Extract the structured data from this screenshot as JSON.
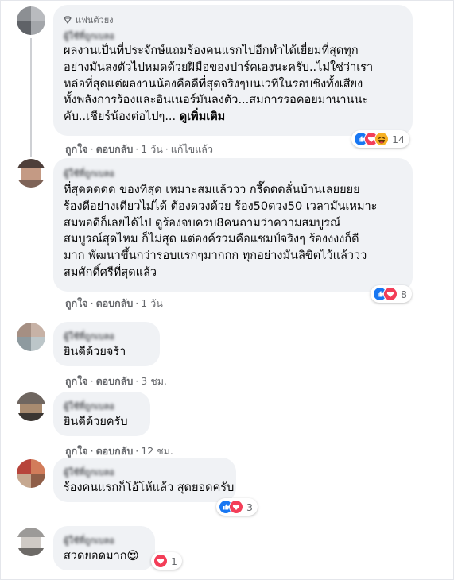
{
  "colors": {
    "bubble": "#f0f2f5",
    "like_blue": "#1877f2",
    "love_red": "#f33e58",
    "haha_yellow": "#f7b125",
    "meta_text": "#65676b"
  },
  "comments": [
    {
      "badge": "แฟนตัวยง",
      "badge_icon": "diamond-icon",
      "author": "ผู้ใช้ที่ถูกเบลอ",
      "lines": [
        "ผลงานเป็นที่ประจักษ์แถมร้องคนแรกไปอีกทำได้เยี่ยมที่สุดทุก",
        "อย่างมันลงตัวไปหมดด้วยฝีมือของปาร์คเองนะครับ..ไม่ใช่ว่าเรา",
        "หล่อที่สุดแต่ผลงานน้องคือดีที่สุดจริงๆบนเวทีในรอบชิงทั้งเสียง",
        "ทั้งพลังการร้องและอินเนอร์มันลงตัว...สมการรอคอยมานานนะ"
      ],
      "last_line": "คับ..เชียร์น้องต่อไปๆ...",
      "see_more": "ดูเพิ่มเติม",
      "like": "ถูกใจ",
      "reply": "ตอบกลับ",
      "time": "1 วัน",
      "edited": "แก้ไขแล้ว",
      "reaction_icons": [
        "like-icon",
        "love-icon",
        "haha-icon"
      ],
      "reaction_count": "14"
    },
    {
      "author": "ผู้ใช้ที่ถูกเบลอ",
      "lines": [
        "ที่สุดดดดด ของที่สุด เหมาะสมแล้ววว กรี๊ดดดลั่นบ้านเลยยยย",
        "ร้องดีอย่างเดียวไม่ได้ ต้องดวงด้วย ร้อง50ดวง50 เวลามันเหมาะ",
        "สมพอดีก็เลยได้ไป ดูร้องจบครบ8คนถามว่าความสมบูรณ์",
        "สมบูรณ์สุดไหม ก็ไม่สุด แต่องค์รวมคือแชมป์จริงๆ ร้องงงงก็ดี",
        "มาก พัฒนาขึ้นกว่ารอบแรกๆมากกก ทุกอย่างมันลิขิตไว้แล้ววว",
        "สมศักดิ์ศรีที่สุดแล้ว"
      ],
      "like": "ถูกใจ",
      "reply": "ตอบกลับ",
      "time": "1 วัน",
      "reaction_icons": [
        "like-icon",
        "love-icon"
      ],
      "reaction_count": "8"
    },
    {
      "author": "ผู้ใช้ที่ถูกเบลอ",
      "lines": [
        "ยินดีด้วยจร้า"
      ],
      "like": "ถูกใจ",
      "reply": "ตอบกลับ",
      "time": "3 ชม."
    },
    {
      "author": "ผู้ใช้ที่ถูกเบลอ",
      "lines": [
        "ยินดีด้วยครับ"
      ],
      "like": "ถูกใจ",
      "reply": "ตอบกลับ",
      "time": "12 ชม."
    },
    {
      "author": "ผู้ใช้ที่ถูกเบลอ",
      "lines": [
        "ร้องคนแรกก็โอ้โห้แล้ว สุดยอดครับ"
      ],
      "reaction_icons": [
        "like-icon",
        "love-icon"
      ],
      "reaction_count": "3"
    },
    {
      "author": "ผู้ใช้ที่ถูกเบลอ",
      "lines": [
        "สวดยอดมาก😍"
      ],
      "reaction_icons": [
        "love-icon"
      ],
      "reaction_count": "1"
    }
  ]
}
